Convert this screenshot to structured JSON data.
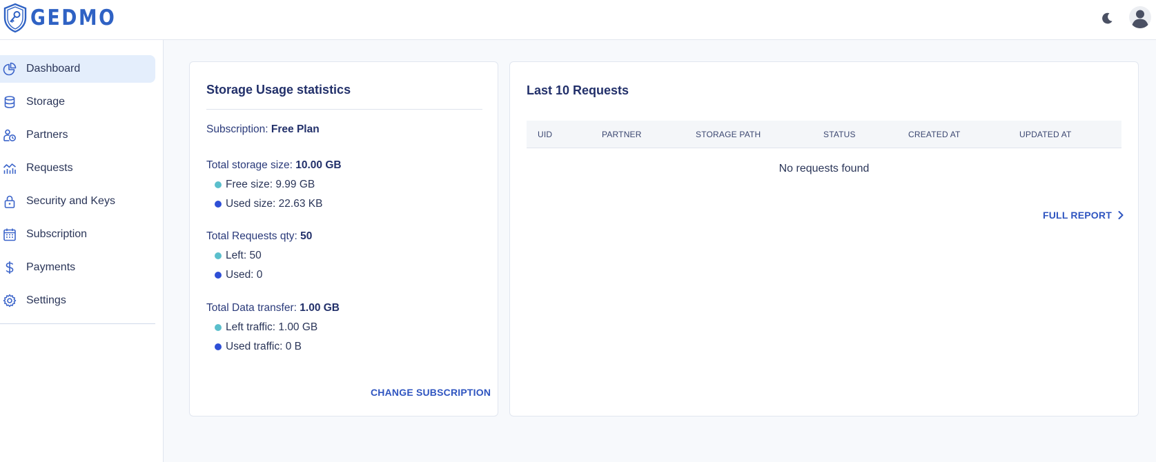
{
  "brand": {
    "name": "GEDMO",
    "color": "#2f62c4"
  },
  "header": {
    "theme_toggle_icon": "moon-icon",
    "user_icon": "user-avatar-icon"
  },
  "sidebar": {
    "items": [
      {
        "label": "Dashboard",
        "icon": "chart-pie-icon",
        "active": true
      },
      {
        "label": "Storage",
        "icon": "database-icon",
        "active": false
      },
      {
        "label": "Partners",
        "icon": "partners-icon",
        "active": false
      },
      {
        "label": "Requests",
        "icon": "chart-line-icon",
        "active": false
      },
      {
        "label": "Security and Keys",
        "icon": "lock-icon",
        "active": false
      },
      {
        "label": "Subscription",
        "icon": "calendar-icon",
        "active": false
      },
      {
        "label": "Payments",
        "icon": "dollar-icon",
        "active": false
      },
      {
        "label": "Settings",
        "icon": "gear-icon",
        "active": false
      }
    ]
  },
  "storage_card": {
    "title": "Storage Usage statistics",
    "subscription_label": "Subscription: ",
    "subscription_value": "Free Plan",
    "total_storage_label": "Total storage size: ",
    "total_storage_value": "10.00 GB",
    "free_size": "Free size: 9.99 GB",
    "used_size": "Used size: 22.63 KB",
    "total_requests_label": "Total Requests qty: ",
    "total_requests_value": "50",
    "requests_left": "Left: 50",
    "requests_used": "Used: 0",
    "total_transfer_label": "Total Data transfer: ",
    "total_transfer_value": "1.00 GB",
    "left_traffic": "Left traffic: 1.00 GB",
    "used_traffic": "Used traffic: 0 B",
    "change_button": "CHANGE SUBSCRIPTION",
    "colors": {
      "free": "#5bbfcc",
      "used": "#2e4fd6"
    }
  },
  "requests_card": {
    "title": "Last 10 Requests",
    "columns": [
      "UID",
      "PARTNER",
      "STORAGE PATH",
      "STATUS",
      "CREATED AT",
      "UPDATED AT"
    ],
    "empty_message": "No requests found",
    "full_report_label": "FULL REPORT"
  }
}
